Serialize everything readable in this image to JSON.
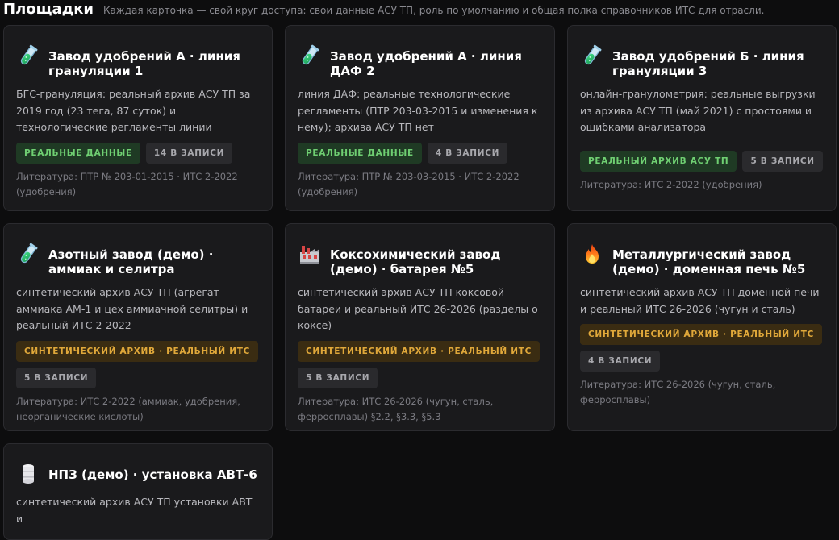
{
  "header": {
    "title": "Площадки",
    "subtitle": "Каждая карточка — свой круг доступа: свои данные АСУ ТП, роль по умолчанию и общая полка справочников ИТС для отрасли."
  },
  "cards": [
    {
      "icon": "test-tube-icon",
      "title": "Завод удобрений А · линия грануляции 1",
      "desc": "БГС-грануляция: реальный архив АСУ ТП за 2019 год (23 тега, 87 суток) и технологические регламенты линии",
      "badges": [
        {
          "label": "РЕАЛЬНЫЕ ДАННЫЕ",
          "kind": "green"
        },
        {
          "label": "14 В ЗАПИСИ",
          "kind": "gray"
        }
      ],
      "lit": "Литература: ПТР № 203-01-2015 · ИТС 2-2022 (удобрения)"
    },
    {
      "icon": "test-tube-icon",
      "title": "Завод удобрений А · линия ДАФ 2",
      "desc": "линия ДАФ: реальные технологические регламенты (ПТР 203-03-2015 и изменения к нему); архива АСУ ТП нет",
      "badges": [
        {
          "label": "РЕАЛЬНЫЕ ДАННЫЕ",
          "kind": "green"
        },
        {
          "label": "4 В ЗАПИСИ",
          "kind": "gray"
        }
      ],
      "lit": "Литература: ПТР № 203-03-2015 · ИТС 2-2022 (удобрения)"
    },
    {
      "icon": "test-tube-icon",
      "title": "Завод удобрений Б · линия грануляции 3",
      "desc": "онлайн-гранулометрия: реальные выгрузки из архива АСУ ТП (май 2021) с простоями и ошибками анализатора",
      "badges": [
        {
          "label": "РЕАЛЬНЫЙ АРХИВ АСУ ТП",
          "kind": "green"
        },
        {
          "label": "5 В ЗАПИСИ",
          "kind": "gray"
        }
      ],
      "lit": "Литература: ИТС 2-2022 (удобрения)"
    },
    {
      "icon": "test-tube-icon",
      "title": "Азотный завод (демо) · аммиак и селитра",
      "desc": "синтетический архив АСУ ТП (агрегат аммиака АМ-1 и цех аммиачной селитры) и реальный ИТС 2-2022",
      "badges": [
        {
          "label": "СИНТЕТИЧЕСКИЙ АРХИВ · РЕАЛЬНЫЙ ИТС",
          "kind": "gold"
        },
        {
          "label": "5 В ЗАПИСИ",
          "kind": "gray"
        }
      ],
      "lit": "Литература: ИТС 2-2022 (аммиак, удобрения, неорганические кислоты)"
    },
    {
      "icon": "factory-icon",
      "title": "Коксохимический завод (демо) · батарея №5",
      "desc": "синтетический архив АСУ ТП коксовой батареи и реальный ИТС 26-2026 (разделы о коксе)",
      "badges": [
        {
          "label": "СИНТЕТИЧЕСКИЙ АРХИВ · РЕАЛЬНЫЙ ИТС",
          "kind": "gold"
        },
        {
          "label": "5 В ЗАПИСИ",
          "kind": "gray"
        }
      ],
      "lit": "Литература: ИТС 26-2026 (чугун, сталь, ферросплавы) §2.2, §3.3, §5.3"
    },
    {
      "icon": "fire-icon",
      "title": "Металлургический завод (демо) · доменная печь №5",
      "desc": "синтетический архив АСУ ТП доменной печи и реальный ИТС 26-2026 (чугун и сталь)",
      "badges": [
        {
          "label": "СИНТЕТИЧЕСКИЙ АРХИВ · РЕАЛЬНЫЙ ИТС",
          "kind": "gold"
        },
        {
          "label": "4 В ЗАПИСИ",
          "kind": "gray"
        }
      ],
      "lit": "Литература: ИТС 26-2026 (чугун, сталь, ферросплавы)"
    },
    {
      "icon": "oil-drum-icon",
      "title": "НПЗ (демо) · установка АВТ-6",
      "desc": "синтетический архив АСУ ТП установки АВТ и",
      "badges": [],
      "lit": ""
    }
  ]
}
